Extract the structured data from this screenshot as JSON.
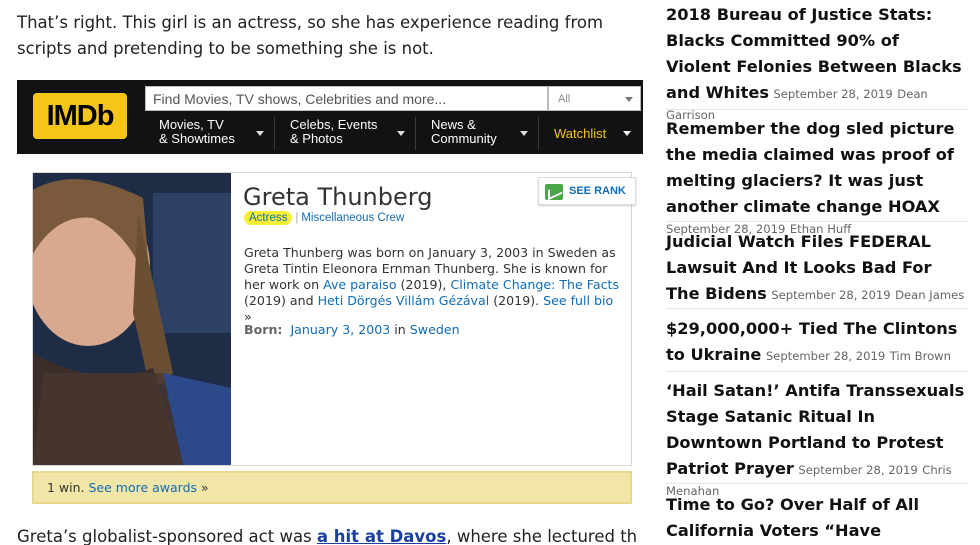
{
  "article": {
    "intro": "That’s right. This girl is an actress, so she has experience reading from scripts and pretending to be something she is not.",
    "outro_before": "Greta’s globalist-sponsored act was ",
    "outro_link": "a hit at Davos",
    "outro_after": ", where she lectured the elite on"
  },
  "imdb": {
    "logo": "IMDb",
    "search_placeholder": "Find Movies, TV shows, Celebrities and more...",
    "search_scope": "All",
    "nav": [
      {
        "line1": "Movies, TV",
        "line2": "& Showtimes"
      },
      {
        "line1": "Celebs, Events",
        "line2": "& Photos"
      },
      {
        "line1": "News &",
        "line2": "Community"
      }
    ],
    "watchlist": "Watchlist",
    "name": "Greta Thunberg",
    "role_actress": "Actress",
    "role_sep": "|",
    "role_other": "Miscellaneous Crew",
    "see_rank": "SEE RANK",
    "bio_1": "Greta Thunberg was born on January 3, 2003 in Sweden as Greta Tintin Eleonora Ernman Thunberg. She is known for her work on ",
    "bio_link1": "Ave paraiso",
    "bio_2": " (2019), ",
    "bio_link2": "Climate Change: The Facts",
    "bio_3": " (2019) and ",
    "bio_link3": "Heti Dörgés Villám Gézával",
    "bio_4": " (2019). ",
    "bio_more": "See full bio",
    "bio_more_arrow": " »",
    "born_label": "Born:",
    "born_date": "January 3, 2003",
    "born_in": " in ",
    "born_place": "Sweden",
    "awards_text": "1 win. ",
    "awards_link": "See more awards",
    "awards_arrow": " »"
  },
  "sidebar": {
    "posts": [
      {
        "title": "2018 Bureau of Justice Stats: Blacks Committed 90% of Violent Felonies Between Blacks and Whites",
        "date": "September 28, 2019",
        "author": "Dean Garrison"
      },
      {
        "title": "Remember the dog sled picture the media claimed was proof of melting glaciers? It was just another climate change HOAX",
        "date": "September 28, 2019",
        "author": "Ethan Huff"
      },
      {
        "title": "Judicial Watch Files FEDERAL Lawsuit And It Looks Bad For The Bidens",
        "date": "September 28, 2019",
        "author": "Dean James"
      },
      {
        "title": "$29,000,000+ Tied The Clintons to Ukraine",
        "date": "September 28, 2019",
        "author": "Tim Brown"
      },
      {
        "title": "‘Hail Satan!’ Antifa Transsexuals Stage Satanic Ritual In Downtown Portland to Protest Patriot Prayer",
        "date": "September 28, 2019",
        "author": "Chris Menahan"
      },
      {
        "title": "Time to Go? Over Half of All California Voters “Have Considered Leaving The",
        "date": "",
        "author": ""
      }
    ]
  },
  "colors": {
    "imdb_yellow": "#f5c518",
    "link_blue": "#136cb2",
    "highlight": "#f5f033"
  }
}
